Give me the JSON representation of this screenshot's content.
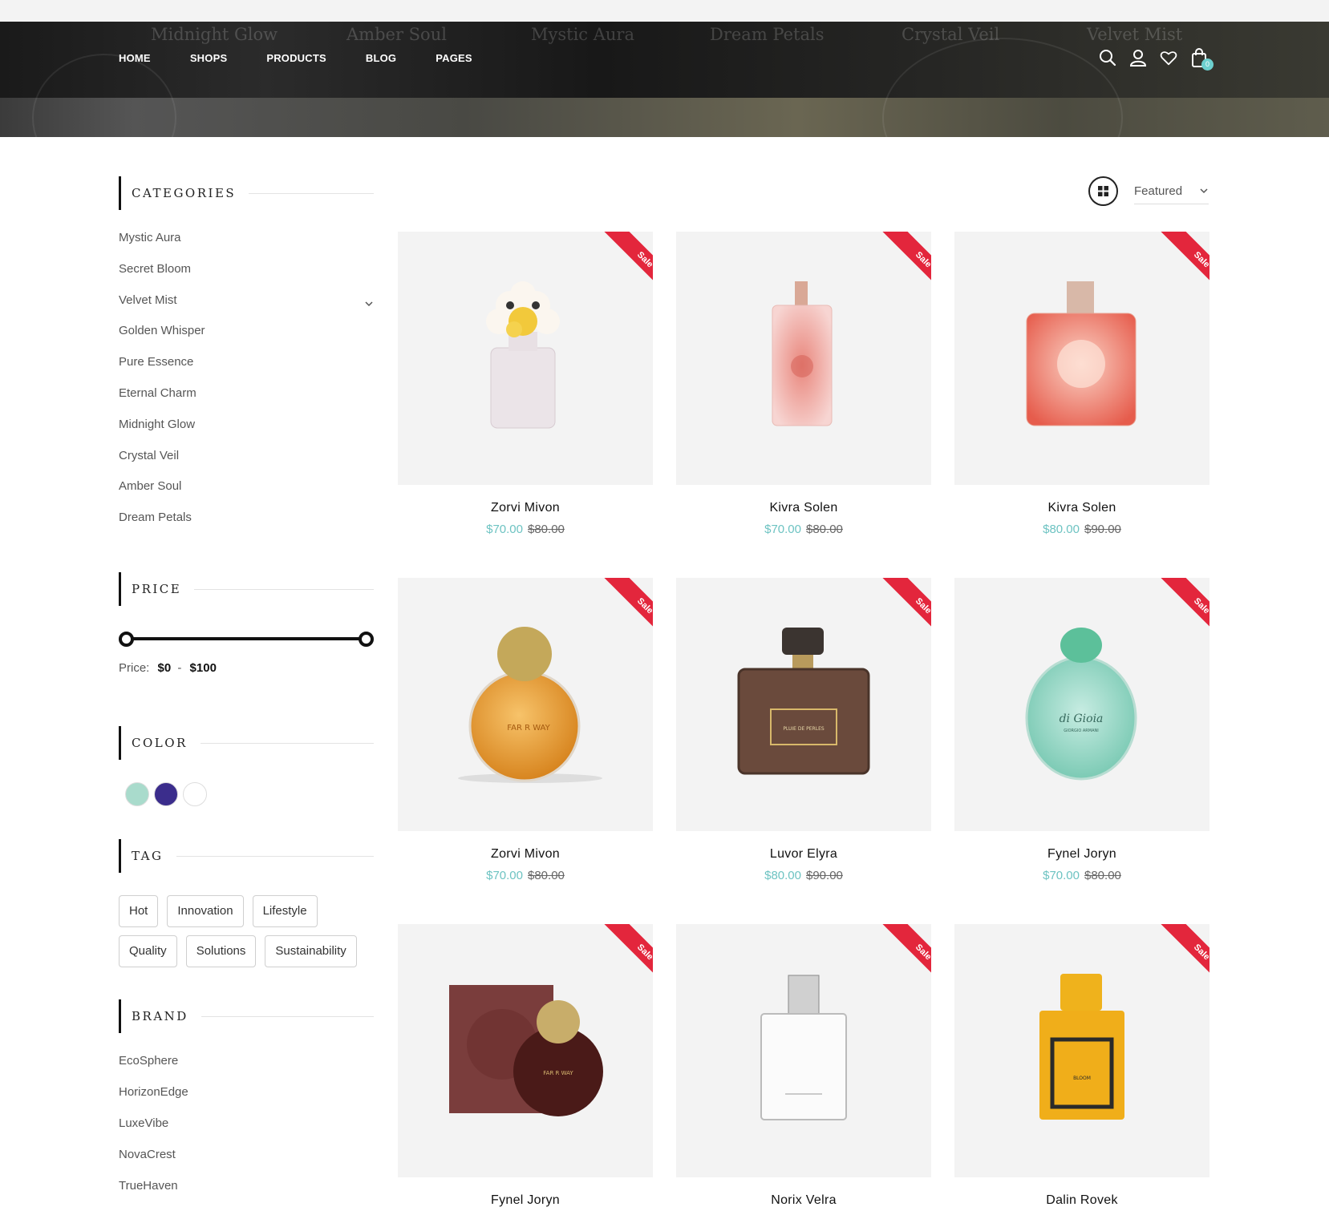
{
  "header": {
    "banner_labels": [
      "Midnight Glow",
      "Amber Soul",
      "Mystic Aura",
      "Dream Petals",
      "Crystal Veil",
      "Velvet Mist"
    ],
    "nav": [
      "HOME",
      "SHOPS",
      "PRODUCTS",
      "BLOG",
      "PAGES"
    ],
    "cart_count": "0",
    "icons": [
      "search-icon",
      "user-icon",
      "heart-icon",
      "bag-icon"
    ]
  },
  "sidebar": {
    "categories_title": "CATEGORIES",
    "categories": [
      "Mystic Aura",
      "Secret Bloom",
      "Velvet Mist",
      "Golden Whisper",
      "Pure Essence",
      "Eternal Charm",
      "Midnight Glow",
      "Crystal Veil",
      "Amber Soul",
      "Dream Petals"
    ],
    "price_title": "PRICE",
    "price_label": "Price:",
    "price_min": "$0",
    "price_sep": "-",
    "price_max": "$100",
    "color_title": "COLOR",
    "colors": [
      "#a9dbcc",
      "#3b2d8c",
      "#ffffff"
    ],
    "tag_title": "TAG",
    "tags": [
      "Hot",
      "Innovation",
      "Lifestyle",
      "Quality",
      "Solutions",
      "Sustainability"
    ],
    "brand_title": "BRAND",
    "brands": [
      "EcoSphere",
      "HorizonEdge",
      "LuxeVibe",
      "NovaCrest",
      "TrueHaven"
    ]
  },
  "toolbar": {
    "sort_label": "Featured"
  },
  "accent": "#6dc3c2",
  "sale_color": "#e3263c",
  "products": [
    {
      "name": "Zorvi Mivon",
      "price": "$70.00",
      "old_price": "$80.00",
      "badge": "Sale"
    },
    {
      "name": "Kivra Solen",
      "price": "$70.00",
      "old_price": "$80.00",
      "badge": "Sale"
    },
    {
      "name": "Kivra Solen",
      "price": "$80.00",
      "old_price": "$90.00",
      "badge": "Sale"
    },
    {
      "name": "Zorvi Mivon",
      "price": "$70.00",
      "old_price": "$80.00",
      "badge": "Sale"
    },
    {
      "name": "Luvor Elyra",
      "price": "$80.00",
      "old_price": "$90.00",
      "badge": "Sale"
    },
    {
      "name": "Fynel Joryn",
      "price": "$70.00",
      "old_price": "$80.00",
      "badge": "Sale"
    },
    {
      "name": "Fynel Joryn",
      "price": "",
      "old_price": "",
      "badge": "Sale"
    },
    {
      "name": "Norix Velra",
      "price": "",
      "old_price": "",
      "badge": "Sale"
    },
    {
      "name": "Dalin Rovek",
      "price": "",
      "old_price": "",
      "badge": "Sale"
    }
  ],
  "bottle_labels": {
    "p4": "FAR R WAY",
    "p5": "PLUIE DE PERLES",
    "p6_line1": "di Gioia",
    "p6_line2": "GIORGIO ARMANI",
    "p7": "FAR R WAY",
    "p9": "BLOOM"
  }
}
